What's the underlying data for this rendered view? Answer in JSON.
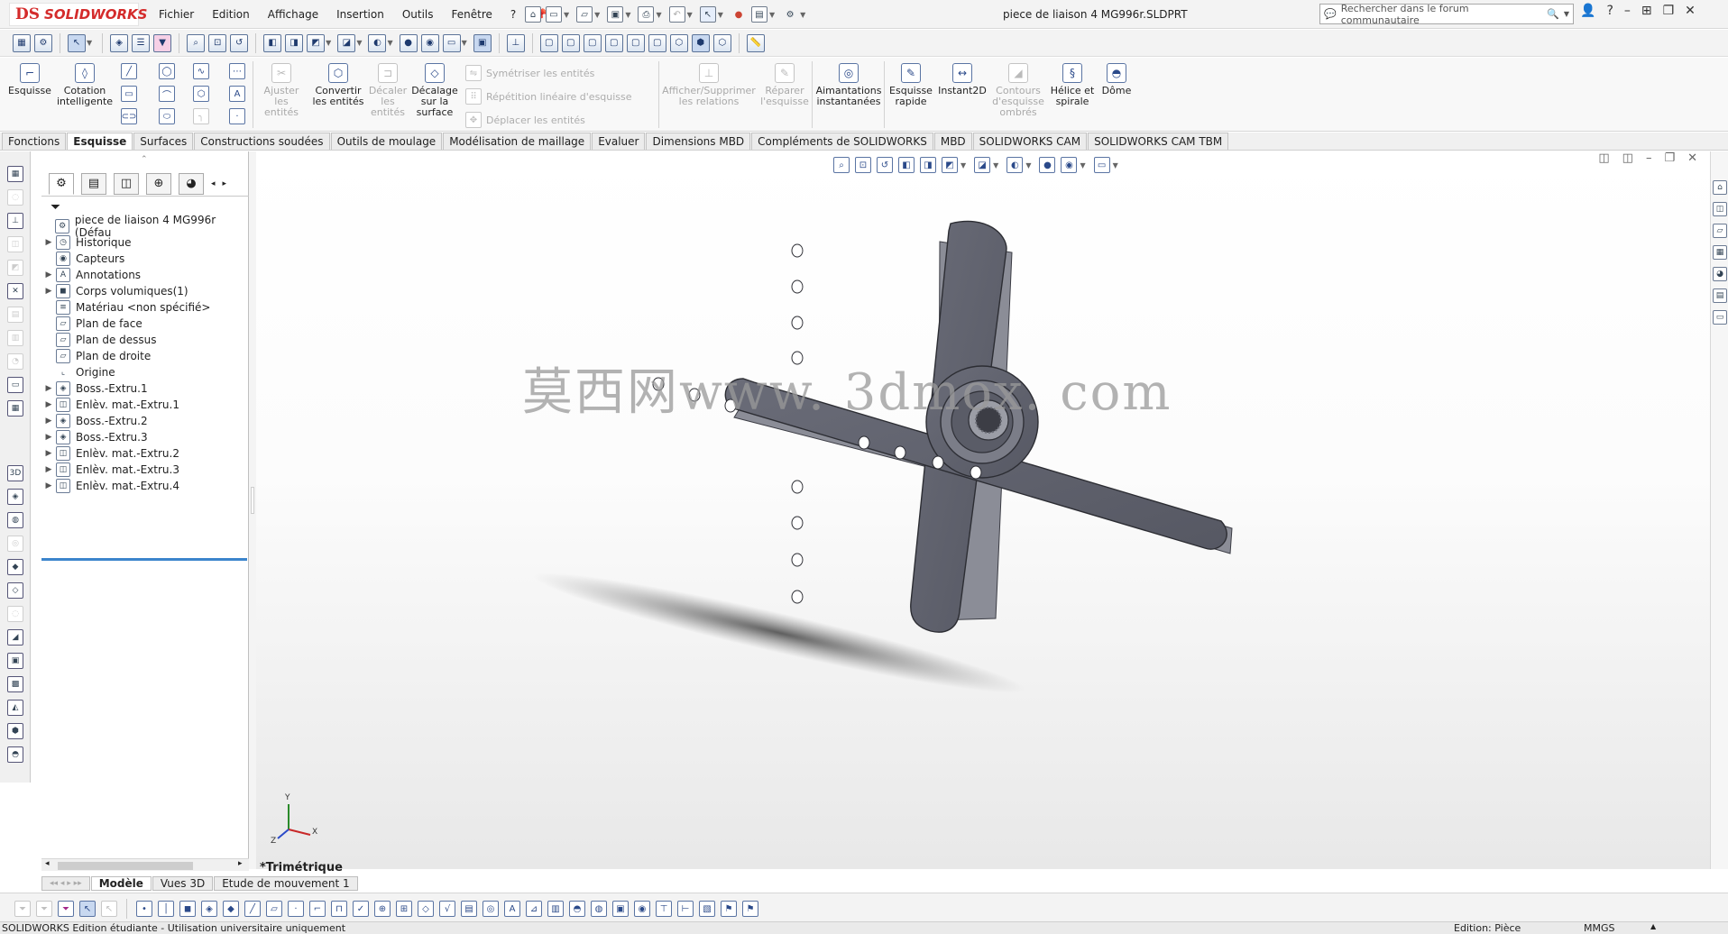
{
  "app": {
    "logo_ds": "DS",
    "logo_name": "SOLIDWORKS",
    "doc_title": "piece de liaison 4 MG996r.SLDPRT"
  },
  "menu": [
    "Fichier",
    "Edition",
    "Affichage",
    "Insertion",
    "Outils",
    "Fenêtre",
    "?"
  ],
  "search": {
    "placeholder": "Rechercher dans le forum communautaire"
  },
  "command_manager": {
    "esquisse": "Esquisse",
    "cotation": "Cotation intelligente",
    "ajuster": "Ajuster les entités",
    "convertir": "Convertir les entités",
    "decaler": "Décaler les entités",
    "decalage_surface": "Décalage sur la surface",
    "symetriser": "Symétriser les entités",
    "repetition": "Répétition linéaire d'esquisse",
    "deplacer": "Déplacer les entités",
    "relations": "Afficher/Supprimer les relations",
    "reparer": "Réparer l'esquisse",
    "aimantations": "Aimantations instantanées",
    "esquisse_rapide": "Esquisse rapide",
    "instant2d": "Instant2D",
    "contours": "Contours d'esquisse ombrés",
    "helice": "Hélice et spirale",
    "dome": "Dôme"
  },
  "tabs": [
    "Fonctions",
    "Esquisse",
    "Surfaces",
    "Constructions soudées",
    "Outils de moulage",
    "Modélisation de maillage",
    "Evaluer",
    "Dimensions MBD",
    "Compléments de SOLIDWORKS",
    "MBD",
    "SOLIDWORKS CAM",
    "SOLIDWORKS CAM TBM"
  ],
  "active_tab": "Esquisse",
  "tree": {
    "root": "piece de liaison 4 MG996r  (Défau",
    "items": [
      "Historique",
      "Capteurs",
      "Annotations",
      "Corps volumiques(1)",
      "Matériau <non spécifié>",
      "Plan de face",
      "Plan de dessus",
      "Plan de droite",
      "Origine",
      "Boss.-Extru.1",
      "Enlèv. mat.-Extru.1",
      "Boss.-Extru.2",
      "Boss.-Extru.3",
      "Enlèv. mat.-Extru.2",
      "Enlèv. mat.-Extru.3",
      "Enlèv. mat.-Extru.4"
    ]
  },
  "viewport": {
    "watermark": "莫西网www. 3dmox. com",
    "view_name": "*Trimétrique",
    "axis_x": "X",
    "axis_y": "Y",
    "axis_z": "Z"
  },
  "bottom_tabs": [
    "Modèle",
    "Vues 3D",
    "Etude de mouvement 1"
  ],
  "status": {
    "left": "SOLIDWORKS Edition étudiante - Utilisation universitaire uniquement",
    "mode": "Edition: Pièce",
    "units": "MMGS"
  }
}
